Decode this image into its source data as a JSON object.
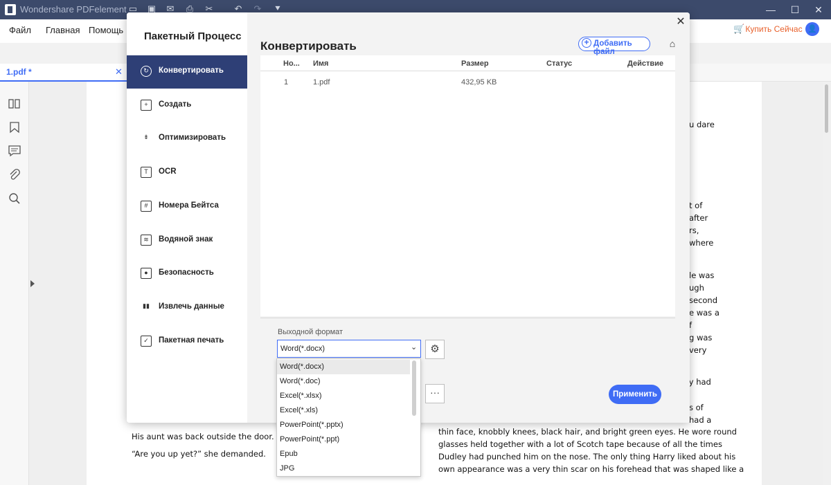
{
  "app": {
    "title": "Wondershare PDFelement",
    "window_controls": [
      "—",
      "☐",
      "✕"
    ]
  },
  "menu": {
    "items": [
      "Файл",
      "Главная",
      "Помощь"
    ],
    "buy_now": "Купить Сейчас",
    "avatar": "👤"
  },
  "tab": {
    "label": "1.pdf *",
    "close": "✕"
  },
  "document": {
    "right_fragments": [
      "u dare",
      "t of",
      "after",
      "rs,",
      "where",
      "le was",
      "ugh",
      "second",
      "e was a",
      "f",
      "g was",
      "very",
      "ry had",
      "s of",
      "had a"
    ],
    "left_lines": [
      "His aunt was back outside the door.",
      "“Are you up yet?” she demanded."
    ],
    "right_lines": [
      "thin face, knobbly knees, black hair, and bright green eyes. He wore round",
      "glasses held together with a lot of Scotch tape because of all the times",
      "Dudley had punched him on the nose. The only thing Harry liked about his",
      "own appearance was a very thin scar on his forehead that was shaped like a"
    ]
  },
  "modal": {
    "nav_title": "Пакетный Процесс",
    "nav_items": [
      {
        "label": "Конвертировать",
        "icon": "convert-icon",
        "active": true
      },
      {
        "label": "Создать",
        "icon": "create-icon",
        "active": false
      },
      {
        "label": "Оптимизировать",
        "icon": "optimize-icon",
        "active": false
      },
      {
        "label": "OCR",
        "icon": "ocr-icon",
        "active": false
      },
      {
        "label": "Номера Бейтса",
        "icon": "bates-icon",
        "active": false
      },
      {
        "label": "Водяной знак",
        "icon": "watermark-icon",
        "active": false
      },
      {
        "label": "Безопасность",
        "icon": "lock-icon",
        "active": false
      },
      {
        "label": "Извлечь данные",
        "icon": "chart-icon",
        "active": false
      },
      {
        "label": "Пакетная печать",
        "icon": "print-icon",
        "active": false
      }
    ],
    "title": "Конвертировать",
    "add_file": "Добавить файл",
    "close": "✕",
    "table": {
      "columns": [
        "Но...",
        "Имя",
        "Размер",
        "Статус",
        "Действие"
      ],
      "rows": [
        {
          "no": "1",
          "name": "1.pdf",
          "size": "432,95 KB",
          "status": "",
          "action": ""
        }
      ]
    },
    "output_label": "Выходной формат",
    "output_value": "Word(*.docx)",
    "more": "···",
    "apply": "Применить",
    "options": [
      "Word(*.docx)",
      "Word(*.doc)",
      "Excel(*.xlsx)",
      "Excel(*.xls)",
      "PowerPoint(*.pptx)",
      "PowerPoint(*.ppt)",
      "Epub",
      "JPG"
    ]
  },
  "colors": {
    "accent": "#3f6cf5",
    "nav_active": "#2e3f76",
    "titlebar": "#3c4a6b",
    "buy": "#e8612c"
  }
}
